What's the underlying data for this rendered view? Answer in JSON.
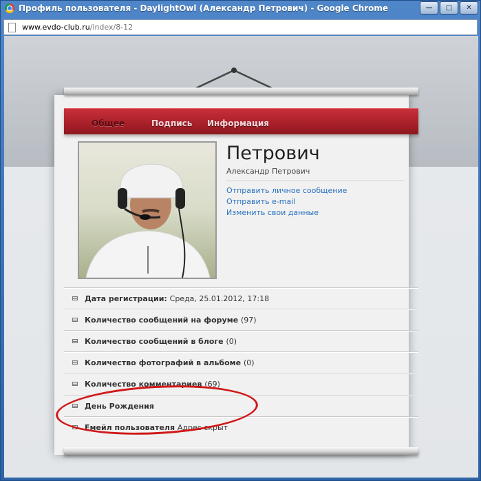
{
  "window": {
    "title": "Профиль пользователя - DaylightOwl (Александр Петрович) - Google Chrome",
    "buttons": [
      "—",
      "□",
      "✕"
    ]
  },
  "address": {
    "domain": "www.evdo-club.ru",
    "path": "/index/8-12"
  },
  "nav": {
    "tabs": [
      "Общее",
      "Подпись",
      "Информация"
    ],
    "active": "Общее"
  },
  "profile": {
    "name": "Петрович",
    "full_name": "Александр Петрович",
    "links": [
      "Отправить личное сообщение",
      "Отправить e-mail",
      "Изменить свои данные"
    ]
  },
  "stats": [
    {
      "label": "Дата регистрации:",
      "value": "Среда, 25.01.2012, 17:18"
    },
    {
      "label": "Количество сообщений на форуме",
      "value": "(97)"
    },
    {
      "label": "Количество сообщений в блоге",
      "value": "(0)"
    },
    {
      "label": "Количество фотографий в альбоме",
      "value": "(0)"
    },
    {
      "label": "Количество комментариев",
      "value": "(69)"
    },
    {
      "label": "День Рождения",
      "value": ""
    },
    {
      "label": "Емейл пользователя",
      "value": "Адрес скрыт"
    }
  ],
  "icons": {
    "stat": "envelope-icon",
    "page": "page-icon",
    "browser": "chrome-icon"
  },
  "colors": {
    "nav": "#a71f28",
    "link": "#2a72c0",
    "highlight": "#d01818"
  }
}
